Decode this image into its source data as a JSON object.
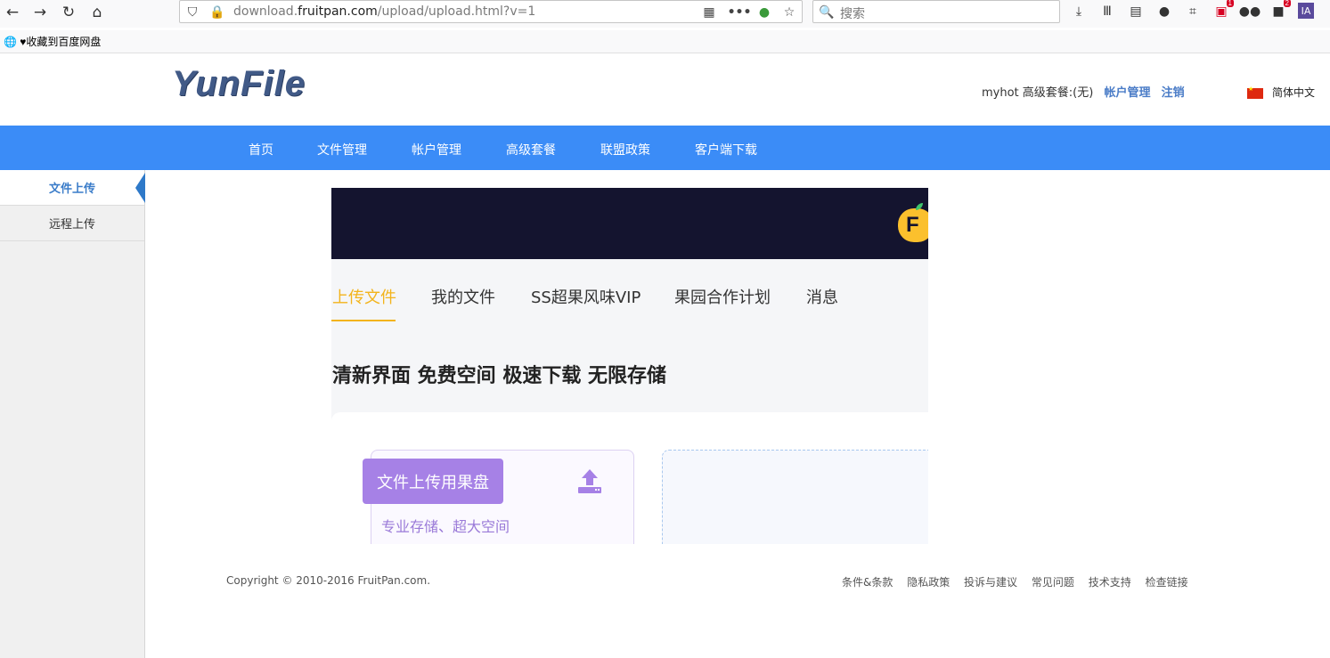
{
  "browser": {
    "url_prefix": "download.",
    "url_domain": "fruitpan.com",
    "url_path": "/upload/upload.html?v=1",
    "search_placeholder": "搜索",
    "badge_1": "1",
    "badge_2": "2",
    "ext_label": "IA",
    "bookmark": "♥收藏到百度网盘"
  },
  "site": {
    "logo": "YunFile",
    "user_info": "myhot 高级套餐:(无)",
    "account_link": "帐户管理",
    "logout_link": "注销",
    "language": "简体中文"
  },
  "nav": [
    "首页",
    "文件管理",
    "帐户管理",
    "高级套餐",
    "联盟政策",
    "客户端下载"
  ],
  "sidebar": [
    "文件上传",
    "远程上传"
  ],
  "frame": {
    "logo_letter": "F",
    "tabs": [
      "上传文件",
      "我的文件",
      "SS超果风味VIP",
      "果园合作计划",
      "消息"
    ],
    "slogan": "清新界面 免费空间 极速下载 无限存储",
    "upload_button": "文件上传用果盘",
    "upload_sub": "专业存储、超大空间"
  },
  "footer": {
    "copyright": "Copyright © 2010-2016 FruitPan.com.",
    "links": [
      "条件&条款",
      "隐私政策",
      "投诉与建议",
      "常见问题",
      "技术支持",
      "检查链接"
    ]
  },
  "colors": {
    "nav_blue": "#3b8cf7",
    "tab_active": "#f3b41c",
    "upload_purple": "#a681e6",
    "banner_dark": "#14142f"
  }
}
